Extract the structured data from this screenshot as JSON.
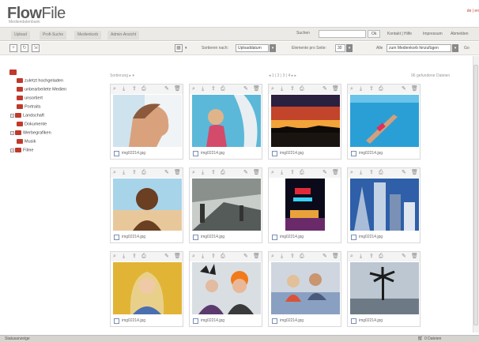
{
  "header": {
    "logo_bold": "Flow",
    "logo_thin": "File",
    "subtitle": "Mediendatenbank",
    "login": "de | en"
  },
  "nav": {
    "tabs": [
      "Upload",
      "Profi-Suche",
      "Medienkorb",
      "Admin-Ansicht"
    ],
    "search_label": "Suchen",
    "search_value": "",
    "search_button": "Ok",
    "links": [
      "Kontakt | Hilfe",
      "Impressum",
      "Abmelden"
    ]
  },
  "toolbar": {
    "sort_label": "Sortieren nach:",
    "sort_value": "Uploaddatum",
    "per_page_label": "Elemente pro Seite:",
    "per_page_value": "30",
    "all_label": "Alle",
    "action_value": "zum Medienkorb hinzufügen",
    "go_label": "Go"
  },
  "sidebar": {
    "items": [
      {
        "label": "zuletzt hochgeladen",
        "expandable": false
      },
      {
        "label": "unbearbeitete Medien",
        "expandable": false
      },
      {
        "label": "unsortiert",
        "expandable": false
      },
      {
        "label": "Portraits",
        "expandable": false
      },
      {
        "label": "Landschaft",
        "expandable": true
      },
      {
        "label": "Dokumente",
        "expandable": false
      },
      {
        "label": "Werbegrafiken",
        "expandable": true
      },
      {
        "label": "Musik",
        "expandable": false
      },
      {
        "label": "Filme",
        "expandable": true
      }
    ]
  },
  "grid": {
    "sort_link": "Sortierung ▸ ▾",
    "pager": "◂ 1 | 2 | 3 | 4 ▸ ▸",
    "found": "96 gefundene Dateien",
    "items": [
      {
        "name": "img02214.jpg",
        "scene": "face-profile"
      },
      {
        "name": "img02214.jpg",
        "scene": "surfboard"
      },
      {
        "name": "img02214.jpg",
        "scene": "sunset"
      },
      {
        "name": "img02214.jpg",
        "scene": "pool"
      },
      {
        "name": "img02214.jpg",
        "scene": "man-smiling"
      },
      {
        "name": "img02214.jpg",
        "scene": "station"
      },
      {
        "name": "img02214.jpg",
        "scene": "neon-sign"
      },
      {
        "name": "img02214.jpg",
        "scene": "skyscrapers"
      },
      {
        "name": "img02214.jpg",
        "scene": "blonde-woman"
      },
      {
        "name": "img02214.jpg",
        "scene": "punk-couple"
      },
      {
        "name": "img02214.jpg",
        "scene": "couple-sofa"
      },
      {
        "name": "img02214.jpg",
        "scene": "palm-beach"
      }
    ]
  },
  "status": {
    "text": "Statusanzeige",
    "cart": "0 Dateien"
  },
  "colors": {
    "accent_red": "#c0392b",
    "nav_bg": "#eceae6",
    "status_bg": "#d6d4cf"
  }
}
